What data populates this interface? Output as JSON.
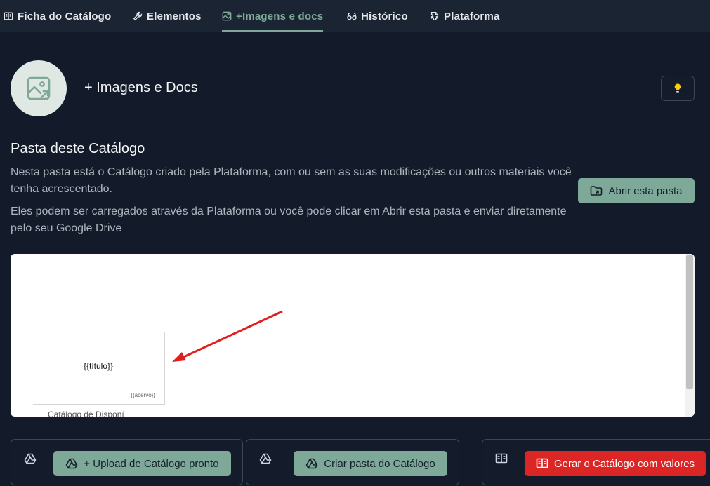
{
  "tabs": [
    {
      "label": "Ficha do Catálogo",
      "icon": "book-icon"
    },
    {
      "label": "Elementos",
      "icon": "wrench-icon"
    },
    {
      "label": "+Imagens e docs",
      "icon": "image-icon",
      "active": true
    },
    {
      "label": "Histórico",
      "icon": "glasses-icon"
    },
    {
      "label": "Plataforma",
      "icon": "puzzle-icon"
    }
  ],
  "header": {
    "title": "+ Imagens e Docs",
    "avatar_icon": "image-icon",
    "hint_icon": "lightbulb-icon"
  },
  "folder": {
    "title": "Pasta deste Catálogo",
    "desc1": "Nesta pasta está o Catálogo criado pela Plataforma, com ou sem as suas modificações ou outros materiais você tenha acrescentado.",
    "desc2": "Eles podem ser carregados através da Plataforma ou você pode clicar em Abrir esta pasta e enviar diretamente pelo seu Google Drive",
    "open_button": "Abrir esta pasta"
  },
  "preview": {
    "thumb_title": "{{título}}",
    "thumb_acervo": "{{acervo}}",
    "thumb_caption": "Catálogo de Disponí"
  },
  "actions": {
    "upload_button": "+ Upload de Catálogo pronto",
    "create_button": "Criar pasta do Catálogo",
    "generate_button": "Gerar o Catálogo com valores"
  },
  "colors": {
    "accent": "#7ea897",
    "danger": "#dc2626",
    "background": "#131b2a"
  }
}
